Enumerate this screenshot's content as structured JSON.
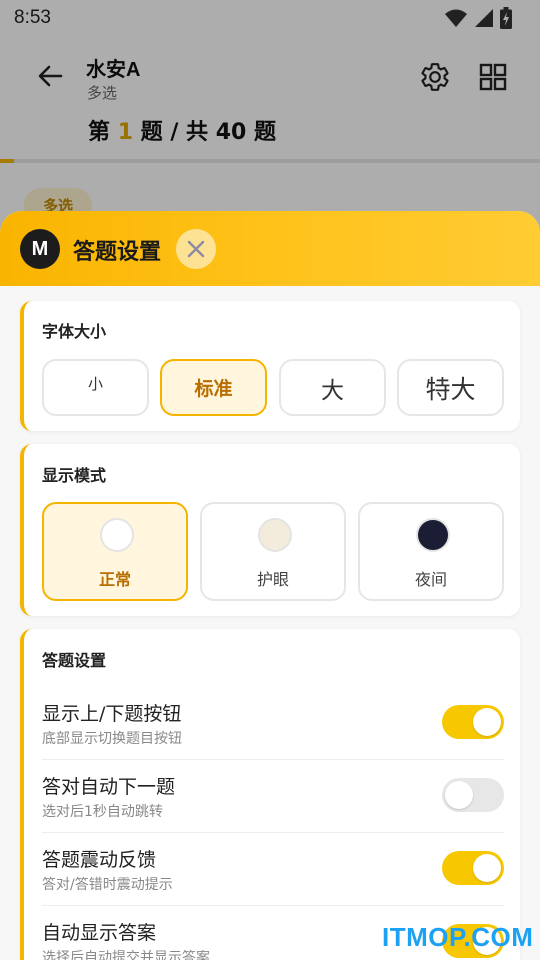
{
  "status": {
    "time": "8:53",
    "icons": [
      "wifi-icon",
      "signal-icon",
      "battery-charging-icon"
    ]
  },
  "header": {
    "title": "水安A",
    "subtitle": "多选",
    "progress_prefix": "第",
    "progress_current": "1",
    "progress_middle": "题 / 共",
    "progress_total": "40",
    "progress_suffix": "题",
    "progress_fraction": 0.025
  },
  "question": {
    "type_badge": "多选"
  },
  "sheet": {
    "logo_letter": "M",
    "title": "答题设置",
    "font_size": {
      "title": "字体大小",
      "options": [
        {
          "label": "小",
          "selected": false
        },
        {
          "label": "标准",
          "selected": true
        },
        {
          "label": "大",
          "selected": false
        },
        {
          "label": "特大",
          "selected": false
        }
      ]
    },
    "display_mode": {
      "title": "显示模式",
      "options": [
        {
          "label": "正常",
          "color": "#ffffff",
          "selected": true
        },
        {
          "label": "护眼",
          "color": "#f3ecdc",
          "selected": false
        },
        {
          "label": "夜间",
          "color": "#1a1d33",
          "selected": false
        }
      ]
    },
    "answer_settings": {
      "title": "答题设置",
      "items": [
        {
          "title": "显示上/下题按钮",
          "subtitle": "底部显示切换题目按钮",
          "on": true
        },
        {
          "title": "答对自动下一题",
          "subtitle": "选对后1秒自动跳转",
          "on": false
        },
        {
          "title": "答题震动反馈",
          "subtitle": "答对/答错时震动提示",
          "on": true
        },
        {
          "title": "自动显示答案",
          "subtitle": "选择后自动提交并显示答案",
          "on": true
        }
      ]
    }
  },
  "watermark": "ITMOP.COM",
  "colors": {
    "accent": "#f5b400",
    "toggle_on": "#f7c800",
    "selected_text": "#b86e00"
  }
}
